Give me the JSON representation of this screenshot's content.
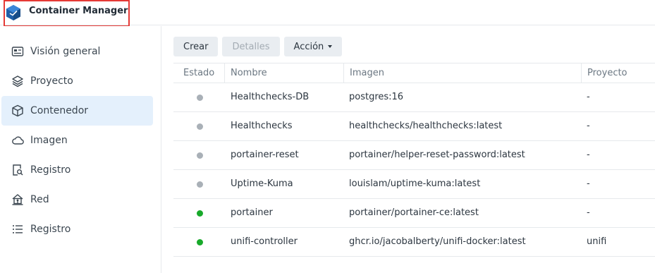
{
  "app": {
    "title": "Container Manager",
    "colors": {
      "accent": "#1d6fd2",
      "highlight_border": "#e53935"
    }
  },
  "sidebar": {
    "items": [
      {
        "label": "Visión general",
        "icon": "overview-card-icon",
        "active": false
      },
      {
        "label": "Proyecto",
        "icon": "layers-icon",
        "active": false
      },
      {
        "label": "Contenedor",
        "icon": "container-cube-icon",
        "active": true
      },
      {
        "label": "Imagen",
        "icon": "cloud-icon",
        "active": false
      },
      {
        "label": "Registro",
        "icon": "registry-search-icon",
        "active": false
      },
      {
        "label": "Red",
        "icon": "network-house-icon",
        "active": false
      },
      {
        "label": "Registro",
        "icon": "log-list-icon",
        "active": false
      }
    ]
  },
  "toolbar": {
    "create_label": "Crear",
    "details_label": "Detalles",
    "action_label": "Acción"
  },
  "table": {
    "headers": {
      "status": "Estado",
      "name": "Nombre",
      "image": "Imagen",
      "project": "Proyecto"
    },
    "rows": [
      {
        "status": "stopped",
        "name": "Healthchecks-DB",
        "image": "postgres:16",
        "project": "-"
      },
      {
        "status": "stopped",
        "name": "Healthchecks",
        "image": "healthchecks/healthchecks:latest",
        "project": "-"
      },
      {
        "status": "stopped",
        "name": "portainer-reset",
        "image": "portainer/helper-reset-password:latest",
        "project": "-"
      },
      {
        "status": "stopped",
        "name": "Uptime-Kuma",
        "image": "louislam/uptime-kuma:latest",
        "project": "-"
      },
      {
        "status": "running",
        "name": "portainer",
        "image": "portainer/portainer-ce:latest",
        "project": "-"
      },
      {
        "status": "running",
        "name": "unifi-controller",
        "image": "ghcr.io/jacobalberty/unifi-docker:latest",
        "project": "unifi"
      }
    ],
    "status_colors": {
      "stopped": "#a9b0b7",
      "running": "#18a92a"
    }
  }
}
